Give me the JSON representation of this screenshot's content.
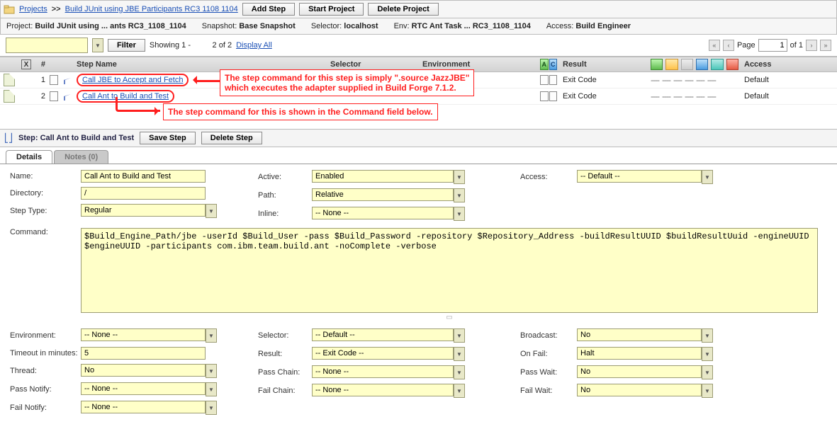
{
  "breadcrumb": {
    "projects": "Projects",
    "current": "Build JUnit using JBE Participants RC3 1108 1104"
  },
  "toolbar": {
    "add_step": "Add Step",
    "start_project": "Start Project",
    "delete_project": "Delete Project"
  },
  "meta": {
    "project_lbl": "Project:",
    "project": "Build JUnit using ... ants RC3_1108_1104",
    "snapshot_lbl": "Snapshot:",
    "snapshot": "Base Snapshot",
    "selector_lbl": "Selector:",
    "selector": "localhost",
    "env_lbl": "Env:",
    "env": "RTC Ant Task ... RC3_1108_1104",
    "access_lbl": "Access:",
    "access": "Build Engineer"
  },
  "filterbar": {
    "filter_btn": "Filter",
    "showing": "Showing 1 -          2 of 2",
    "display_all": "Display All",
    "page_lbl": "Page",
    "page_val": "1",
    "page_of": "of 1"
  },
  "grid": {
    "head": {
      "num": "#",
      "name": "Step Name",
      "selector": "Selector",
      "env": "Environment",
      "result": "Result",
      "access": "Access"
    },
    "rows": [
      {
        "n": "1",
        "name": "Call JBE to Accept and Fetch",
        "result": "Exit Code",
        "access": "Default"
      },
      {
        "n": "2",
        "name": "Call Ant to Build and Test",
        "result": "Exit Code",
        "access": "Default"
      }
    ]
  },
  "callouts": {
    "c1": "The step command for this step is simply \".source JazzJBE\"\nwhich executes the adapter supplied in Build Forge 7.1.2.",
    "c2": "The step command for this is shown in the Command field below."
  },
  "step_bar": {
    "label": "Step:",
    "name": "Call Ant to Build and Test",
    "save": "Save Step",
    "delete": "Delete Step"
  },
  "tabs": {
    "details": "Details",
    "notes": "Notes (0)"
  },
  "form": {
    "name_lbl": "Name:",
    "name": "Call Ant to Build and Test",
    "dir_lbl": "Directory:",
    "dir": "/",
    "steptype_lbl": "Step Type:",
    "steptype": "Regular",
    "active_lbl": "Active:",
    "active": "Enabled",
    "path_lbl": "Path:",
    "path": "Relative",
    "inline_lbl": "Inline:",
    "inline": "-- None --",
    "access_lbl": "Access:",
    "access": "-- Default --",
    "command_lbl": "Command:",
    "command": "$Build_Engine_Path/jbe -userId $Build_User -pass $Build_Password -repository $Repository_Address -buildResultUUID $buildResultUuid -engineUUID $engineUUID -participants com.ibm.team.build.ant -noComplete -verbose",
    "env_lbl": "Environment:",
    "env": "-- None --",
    "timeout_lbl": "Timeout in minutes:",
    "timeout": "5",
    "thread_lbl": "Thread:",
    "thread": "No",
    "passnotify_lbl": "Pass Notify:",
    "passnotify": "-- None --",
    "failnotify_lbl": "Fail Notify:",
    "failnotify": "-- None --",
    "selector_lbl": "Selector:",
    "selector": "-- Default --",
    "result_lbl": "Result:",
    "result": "-- Exit Code --",
    "passchain_lbl": "Pass Chain:",
    "passchain": "-- None --",
    "failchain_lbl": "Fail Chain:",
    "failchain": "-- None --",
    "broadcast_lbl": "Broadcast:",
    "broadcast": "No",
    "onfail_lbl": "On Fail:",
    "onfail": "Halt",
    "passwait_lbl": "Pass Wait:",
    "passwait": "No",
    "failwait_lbl": "Fail Wait:",
    "failwait": "No"
  }
}
